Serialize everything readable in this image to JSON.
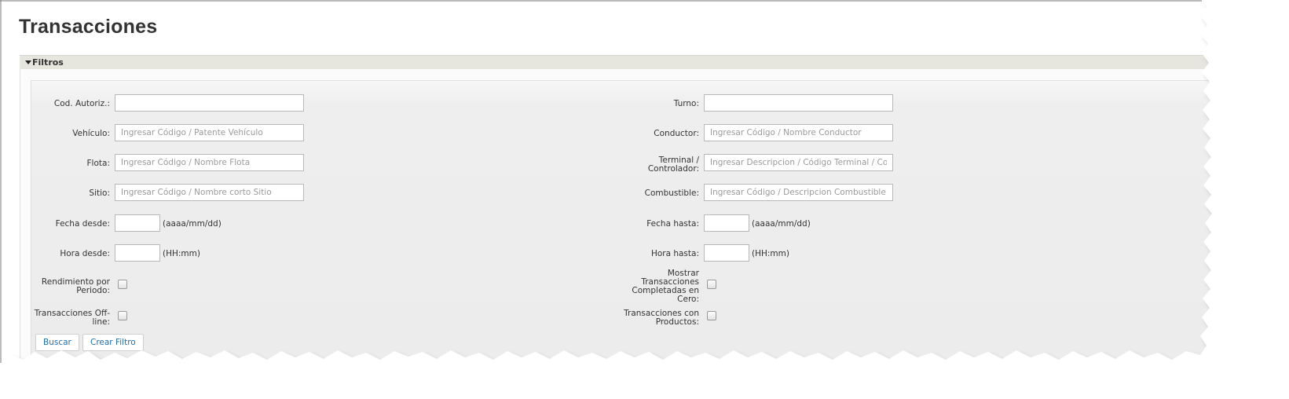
{
  "page": {
    "title": "Transacciones"
  },
  "filters": {
    "header_label": "Filtros",
    "cod_autoriz": {
      "label": "Cod. Autoriz.:",
      "value": "",
      "placeholder": ""
    },
    "turno": {
      "label": "Turno:",
      "value": "",
      "placeholder": ""
    },
    "vehiculo": {
      "label": "Vehículo:",
      "value": "",
      "placeholder": "Ingresar Código / Patente Vehículo"
    },
    "conductor": {
      "label": "Conductor:",
      "value": "",
      "placeholder": "Ingresar Código / Nombre Conductor"
    },
    "flota": {
      "label": "Flota:",
      "value": "",
      "placeholder": "Ingresar Código / Nombre Flota"
    },
    "terminal": {
      "label_line1": "Terminal /",
      "label_line2": "Controlador:",
      "value": "",
      "placeholder": "Ingresar Descripcion / Código Terminal / Contro"
    },
    "sitio": {
      "label": "Sitio:",
      "value": "",
      "placeholder": "Ingresar Código / Nombre corto Sitio"
    },
    "combustible": {
      "label": "Combustible:",
      "value": "",
      "placeholder": "Ingresar Código / Descripcion Combustible"
    },
    "fecha_desde": {
      "label": "Fecha desde:",
      "value": "",
      "hint": "(aaaa/mm/dd)"
    },
    "fecha_hasta": {
      "label": "Fecha hasta:",
      "value": "",
      "hint": "(aaaa/mm/dd)"
    },
    "hora_desde": {
      "label": "Hora desde:",
      "value": "",
      "hint": "(HH:mm)"
    },
    "hora_hasta": {
      "label": "Hora hasta:",
      "value": "",
      "hint": "(HH:mm)"
    },
    "rendimiento": {
      "label_line1": "Rendimiento por",
      "label_line2": "Periodo:",
      "checked": false
    },
    "completadas_cero": {
      "label_line1": "Mostrar",
      "label_line2": "Transacciones",
      "label_line3": "Completadas en",
      "label_line4": "Cero:",
      "checked": false
    },
    "offline": {
      "label_line1": "Transacciones Off-",
      "label_line2": "line:",
      "checked": false
    },
    "con_productos": {
      "label_line1": "Transacciones con",
      "label_line2": "Productos:",
      "checked": false
    }
  },
  "buttons": {
    "buscar": "Buscar",
    "crear_filtro": "Crear Filtro"
  },
  "colors": {
    "link_blue": "#1a6fb5",
    "header_bg": "#e6e5de",
    "panel_bg": "#ececec"
  }
}
